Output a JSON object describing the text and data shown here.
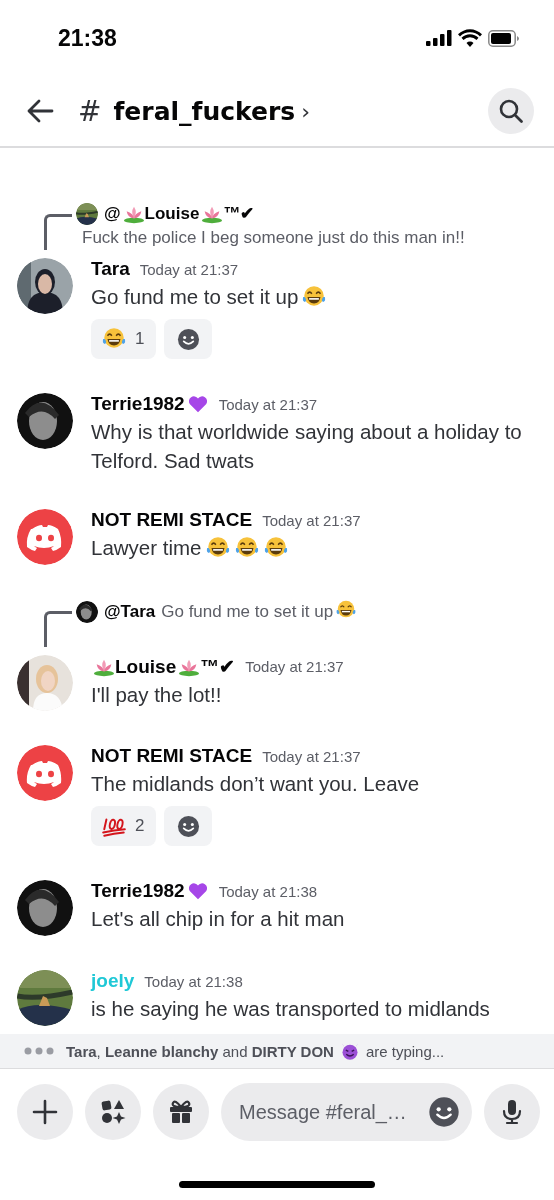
{
  "status_bar": {
    "time": "21:38"
  },
  "header": {
    "hash": "#",
    "channel": "feral_fuckers",
    "chevron": "›"
  },
  "messages": [
    {
      "reply": {
        "avatar": {
          "kind": "picture"
        },
        "author": [
          {
            "kind": "text",
            "text": "@"
          },
          {
            "kind": "lotus"
          },
          {
            "kind": "text",
            "text": "Louise"
          },
          {
            "kind": "lotus"
          },
          {
            "kind": "text",
            "text": "™✔"
          }
        ],
        "preview": [
          {
            "kind": "text",
            "text": "Fuck the police I beg someone just do this man in!!"
          }
        ]
      },
      "avatar": {
        "kind": "picture"
      },
      "author": [
        {
          "kind": "text",
          "text": "Tara"
        }
      ],
      "color": "#060607",
      "time": "Today at 21:37",
      "body": [
        {
          "kind": "text",
          "text": "Go fund me to set it up"
        },
        {
          "kind": "laugh"
        }
      ],
      "reactions": [
        {
          "kind": "laugh",
          "count": "1"
        }
      ]
    },
    {
      "avatar": {
        "kind": "picture"
      },
      "author": [
        {
          "kind": "text",
          "text": "Terrie1982"
        },
        {
          "kind": "heart"
        }
      ],
      "color": "#060607",
      "time": "Today at 21:37",
      "body": [
        {
          "kind": "text",
          "text": "Why is that worldwide saying about a holiday to Telford. Sad twats"
        }
      ]
    },
    {
      "avatar": {
        "kind": "logo"
      },
      "author": [
        {
          "kind": "text",
          "text": "NOT REMI STACE"
        }
      ],
      "color": "#060607",
      "time": "Today at 21:37",
      "body": [
        {
          "kind": "text",
          "text": "Lawyer time"
        },
        {
          "kind": "laugh"
        },
        {
          "kind": "laugh"
        },
        {
          "kind": "laugh"
        }
      ]
    },
    {
      "reply": {
        "avatar": {
          "kind": "picture"
        },
        "author": [
          {
            "kind": "text",
            "text": "@Tara"
          }
        ],
        "preview": [
          {
            "kind": "text",
            "text": "Go fund me to set it up"
          },
          {
            "kind": "laugh"
          }
        ]
      },
      "avatar": {
        "kind": "picture"
      },
      "author": [
        {
          "kind": "lotus"
        },
        {
          "kind": "text",
          "text": "Louise"
        },
        {
          "kind": "lotus"
        },
        {
          "kind": "text",
          "text": "™✔"
        }
      ],
      "color": "#060607",
      "time": "Today at 21:37",
      "body": [
        {
          "kind": "text",
          "text": "I'll pay the lot!!"
        }
      ]
    },
    {
      "avatar": {
        "kind": "logo"
      },
      "author": [
        {
          "kind": "text",
          "text": "NOT REMI STACE"
        }
      ],
      "color": "#060607",
      "time": "Today at 21:37",
      "body": [
        {
          "kind": "text",
          "text": "The midlands don’t want you. Leave"
        }
      ],
      "reactions": [
        {
          "kind": "hundred",
          "count": "2"
        }
      ]
    },
    {
      "avatar": {
        "kind": "picture"
      },
      "author": [
        {
          "kind": "text",
          "text": "Terrie1982"
        },
        {
          "kind": "heart"
        }
      ],
      "color": "#060607",
      "time": "Today at 21:38",
      "body": [
        {
          "kind": "text",
          "text": "Let's all chip in for a hit man"
        }
      ]
    },
    {
      "avatar": {
        "kind": "picture"
      },
      "author": [
        {
          "kind": "text",
          "text": "joely"
        }
      ],
      "color": "#1fc8d6",
      "time": "Today at 21:38",
      "body": [
        {
          "kind": "text",
          "text": "is he saying he was transported to midlands"
        }
      ]
    }
  ],
  "typing": {
    "names": "**Tara**, **Leanne blanchy** and **DIRTY DON**",
    "suffix": "are typing..."
  },
  "composer": {
    "placeholder": "Message #feral_…"
  }
}
